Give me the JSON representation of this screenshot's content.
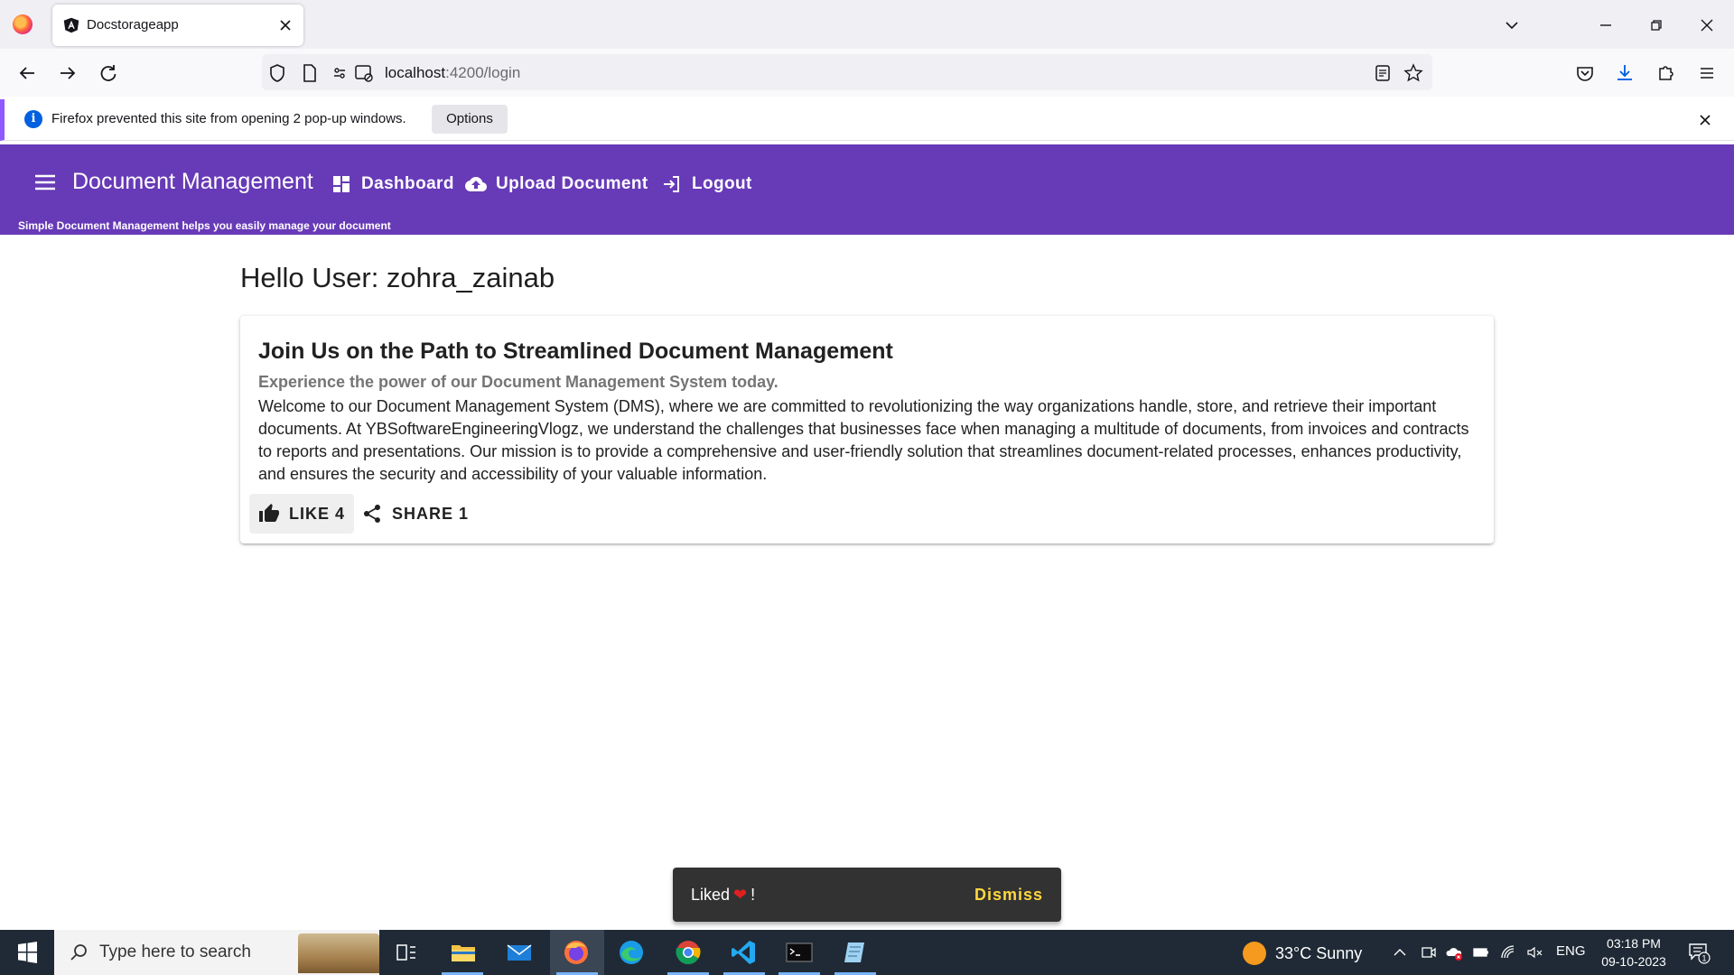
{
  "browser": {
    "tab_title": "Docstorageapp",
    "url_host": "localhost",
    "url_path": ":4200/login"
  },
  "notification": {
    "message": "Firefox prevented this site from opening 2 pop-up windows.",
    "options_label": "Options"
  },
  "app": {
    "title": "Document Management",
    "subtitle": "Simple Document Management helps you easily manage your document",
    "nav": {
      "dashboard": "Dashboard",
      "upload": "Upload Document",
      "logout": "Logout"
    }
  },
  "content": {
    "greeting": "Hello User: zohra_zainab",
    "card": {
      "title": "Join Us on the Path to Streamlined Document Management",
      "subtitle": "Experience the power of our Document Management System today.",
      "body": "Welcome to our Document Management System (DMS), where we are committed to revolutionizing the way organizations handle, store, and retrieve their important documents. At YBSoftwareEngineeringVlogz, we understand the challenges that businesses face when managing a multitude of documents, from invoices and contracts to reports and presentations. Our mission is to provide a comprehensive and user-friendly solution that streamlines document-related processes, enhances productivity, and ensures the security and accessibility of your valuable information.",
      "like_label": "LIKE 4",
      "share_label": "SHARE 1"
    }
  },
  "snackbar": {
    "message": "Liked",
    "suffix": "!",
    "action": "Dismiss"
  },
  "taskbar": {
    "search_placeholder": "Type here to search",
    "weather": "33°C  Sunny",
    "language": "ENG",
    "time": "03:18 PM",
    "date": "09-10-2023",
    "notification_count": "1"
  },
  "colors": {
    "primary": "#673ab7",
    "snackbar_bg": "#323232",
    "snackbar_action": "#ffd740",
    "taskbar_bg": "#1f2a36"
  }
}
